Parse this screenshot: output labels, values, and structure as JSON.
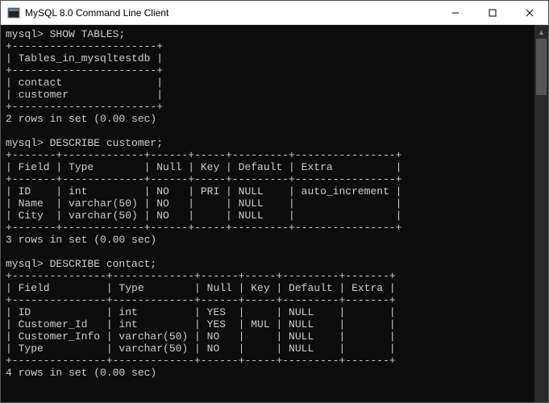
{
  "titlebar": {
    "title": "MySQL 8.0 Command Line Client"
  },
  "prompt": "mysql>",
  "commands": {
    "show_tables": "SHOW TABLES;",
    "describe_customer": "DESCRIBE customer;",
    "describe_contact": "DESCRIBE contact;"
  },
  "tables_result": {
    "header": "Tables_in_mysqltestdb",
    "rows": [
      "contact",
      "customer"
    ],
    "footer": "2 rows in set (0.00 sec)"
  },
  "describe_customer_result": {
    "columns": [
      "Field",
      "Type",
      "Null",
      "Key",
      "Default",
      "Extra"
    ],
    "rows": [
      {
        "Field": "ID",
        "Type": "int",
        "Null": "NO",
        "Key": "PRI",
        "Default": "NULL",
        "Extra": "auto_increment"
      },
      {
        "Field": "Name",
        "Type": "varchar(50)",
        "Null": "NO",
        "Key": "",
        "Default": "NULL",
        "Extra": ""
      },
      {
        "Field": "City",
        "Type": "varchar(50)",
        "Null": "NO",
        "Key": "",
        "Default": "NULL",
        "Extra": ""
      }
    ],
    "footer": "3 rows in set (0.00 sec)"
  },
  "describe_contact_result": {
    "columns": [
      "Field",
      "Type",
      "Null",
      "Key",
      "Default",
      "Extra"
    ],
    "rows": [
      {
        "Field": "ID",
        "Type": "int",
        "Null": "YES",
        "Key": "",
        "Default": "NULL",
        "Extra": ""
      },
      {
        "Field": "Customer_Id",
        "Type": "int",
        "Null": "YES",
        "Key": "MUL",
        "Default": "NULL",
        "Extra": ""
      },
      {
        "Field": "Customer_Info",
        "Type": "varchar(50)",
        "Null": "NO",
        "Key": "",
        "Default": "NULL",
        "Extra": ""
      },
      {
        "Field": "Type",
        "Type": "varchar(50)",
        "Null": "NO",
        "Key": "",
        "Default": "NULL",
        "Extra": ""
      }
    ],
    "footer": "4 rows in set (0.00 sec)"
  }
}
